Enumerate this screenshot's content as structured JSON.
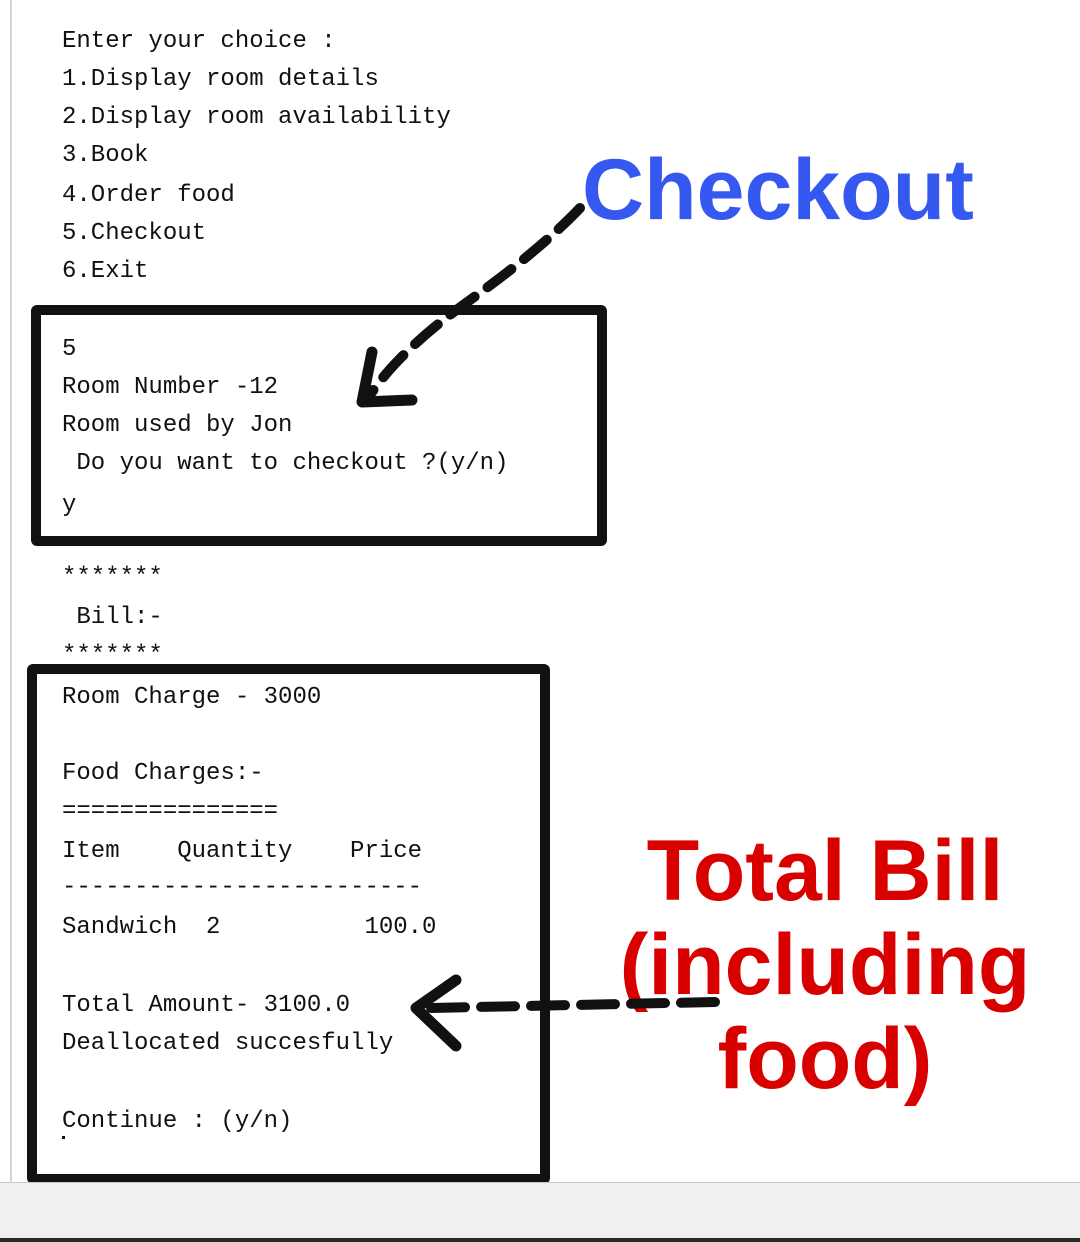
{
  "menu": {
    "prompt": "Enter your choice :",
    "items": [
      "1.Display room details",
      "2.Display room availability",
      "3.Book",
      "4.Order food",
      "5.Checkout",
      "6.Exit"
    ]
  },
  "checkout": {
    "input": "5",
    "room_number": "Room Number -12",
    "room_user": "Room used by Jon",
    "question": " Do you want to checkout ?(y/n)",
    "answer": "y"
  },
  "bill_header": {
    "stars_top": "*******",
    "title": " Bill:-",
    "stars_bottom": "*******"
  },
  "bill": {
    "room_charge": "Room Charge - 3000",
    "food_charges": "Food Charges:-",
    "separator": "===============",
    "table_header": "Item    Quantity    Price",
    "table_rule": "-------------------------",
    "rows": [
      "Sandwich  2          100.0"
    ],
    "total": "Total Amount- 3100.0",
    "status": "Deallocated succesfully",
    "continue_prompt": "Continue : (y/n)"
  },
  "annotations": {
    "checkout_label": "Checkout",
    "checkout_color": "#3558f0",
    "total_label_lines": [
      "Total Bill",
      "(including",
      "food)"
    ],
    "total_color": "#d90000"
  }
}
